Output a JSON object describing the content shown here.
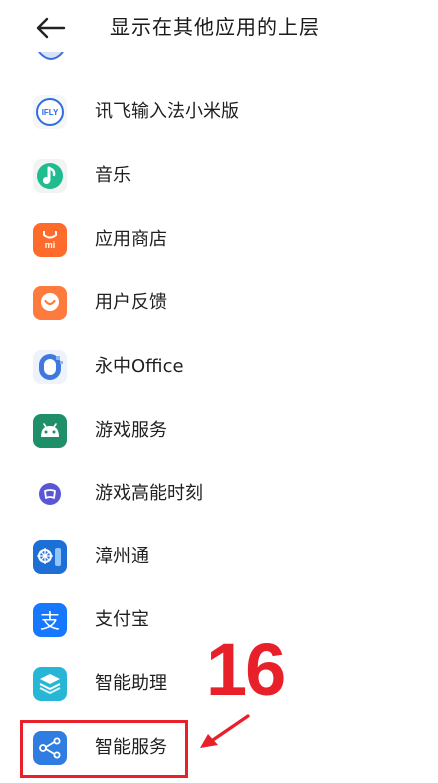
{
  "header": {
    "title": "显示在其他应用的上层"
  },
  "apps": [
    {
      "label": "讯飞输入法小米版",
      "icon": "ifly-icon",
      "icon_text": "IFLY"
    },
    {
      "label": "音乐",
      "icon": "music-icon"
    },
    {
      "label": "应用商店",
      "icon": "app-store-icon",
      "icon_text": "mi"
    },
    {
      "label": "用户反馈",
      "icon": "feedback-icon"
    },
    {
      "label": "永中Office",
      "icon": "office-icon"
    },
    {
      "label": "游戏服务",
      "icon": "android-icon"
    },
    {
      "label": "游戏高能时刻",
      "icon": "game-moment-icon"
    },
    {
      "label": "漳州通",
      "icon": "zhangzhoutong-icon"
    },
    {
      "label": "支付宝",
      "icon": "alipay-icon",
      "icon_text": "支"
    },
    {
      "label": "智能助理",
      "icon": "assistant-layers-icon"
    },
    {
      "label": "智能服务",
      "icon": "share-nodes-icon"
    }
  ],
  "annotation": {
    "number": "16",
    "color": "#e8202a"
  }
}
